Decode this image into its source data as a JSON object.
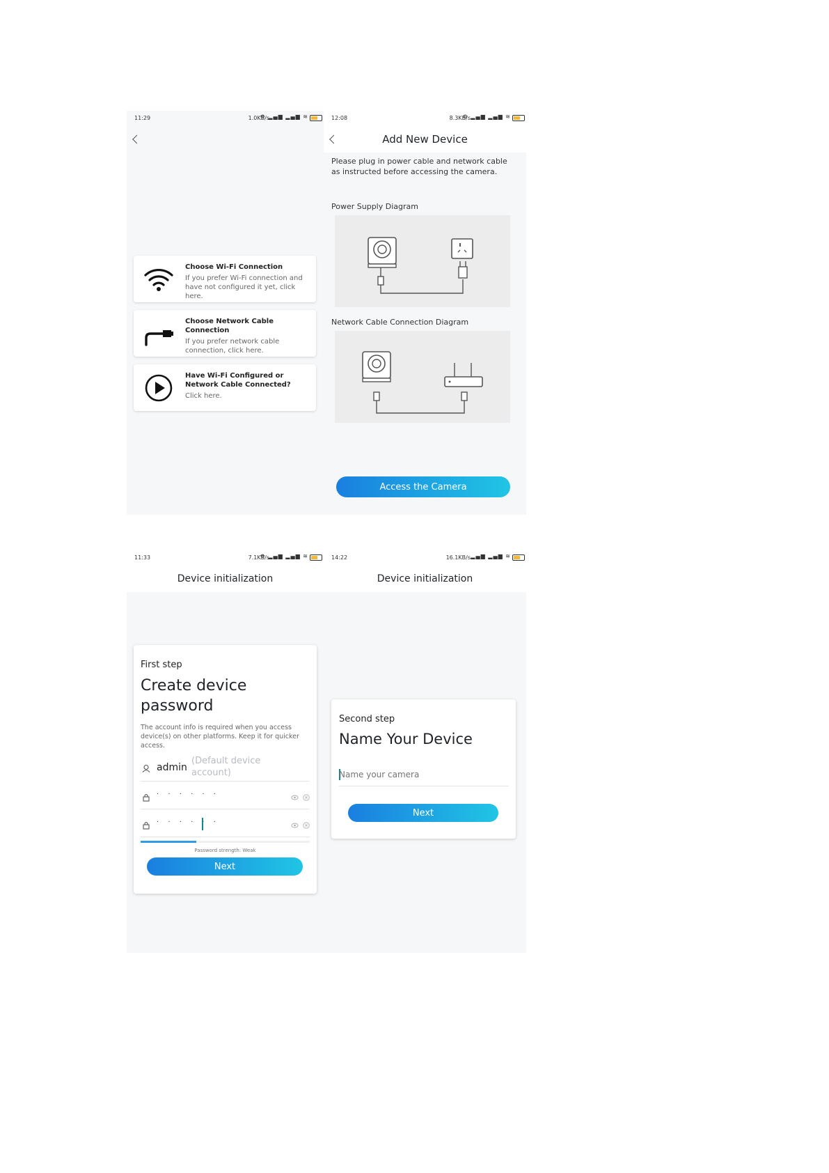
{
  "screen1": {
    "status": {
      "time": "11:29",
      "net": "1.0KB/s"
    },
    "options": [
      {
        "title": "Choose Wi-Fi Connection",
        "desc": "If you prefer Wi-Fi connection and have not configured it yet, click here.",
        "icon": "wifi-icon"
      },
      {
        "title": "Choose Network Cable Connection",
        "desc": "If you prefer network cable connection, click here.",
        "icon": "ethernet-cable-icon"
      },
      {
        "title": "Have Wi-Fi Configured or Network Cable Connected?",
        "desc": "Click here.",
        "icon": "play-icon"
      }
    ]
  },
  "screen2": {
    "status": {
      "time": "12:08",
      "net": "8.3KB/s"
    },
    "title": "Add New Device",
    "instruction": "Please plug in power cable and network cable as instructed before accessing the camera.",
    "power_label": "Power Supply Diagram",
    "network_label": "Network Cable Connection Diagram",
    "button": "Access the Camera"
  },
  "screen3": {
    "status": {
      "time": "11:33",
      "net": "7.1KB/s"
    },
    "title": "Device initialization",
    "step": "First step",
    "heading": "Create device password",
    "desc": "The account info is required when you access device(s) on other platforms. Keep it for quicker access.",
    "username": "admin",
    "username_hint": "(Default device account)",
    "password_mask": "· · · · · ·",
    "confirm_mask": "· · · · · ·",
    "strength_label": "Password strength: Weak",
    "strength_level": 0.33,
    "button": "Next"
  },
  "screen4": {
    "status": {
      "time": "14:22",
      "net": "16.1KB/s"
    },
    "title": "Device initialization",
    "step": "Second step",
    "heading": "Name Your Device",
    "placeholder": "Name your camera",
    "button": "Next"
  },
  "colors": {
    "accent_start": "#1a7fe0",
    "accent_end": "#20c5e4",
    "background": "#f6f7f8"
  }
}
